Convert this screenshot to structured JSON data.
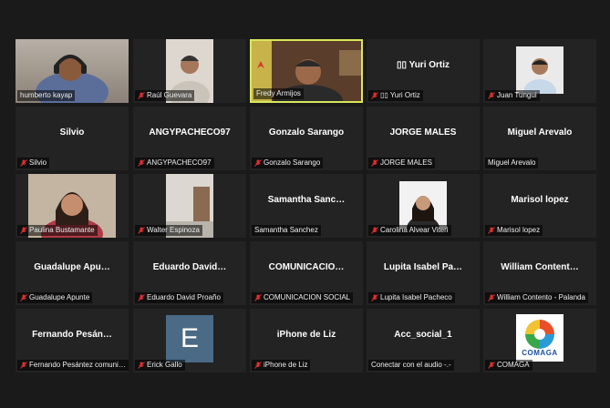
{
  "meeting": {
    "participants": [
      {
        "id": "humberto",
        "display": "video",
        "label": "humberto kayap",
        "muted": false
      },
      {
        "id": "raul",
        "display": "video",
        "label": "Raúl Guevara",
        "muted": true
      },
      {
        "id": "fredy",
        "display": "video",
        "label": "Fredy Armijos",
        "muted": false,
        "active": true
      },
      {
        "id": "yuri",
        "display": "name",
        "center_name": "▯▯ Yuri  Ortiz",
        "label": "▯▯ Yuri Ortiz",
        "muted": true
      },
      {
        "id": "juan",
        "display": "video",
        "label": "Juan Tungui",
        "muted": true
      },
      {
        "id": "silvio",
        "display": "name",
        "center_name": "Silvio",
        "label": "Silvio",
        "muted": true
      },
      {
        "id": "angy",
        "display": "name",
        "center_name": "ANGYPACHECO97",
        "label": "ANGYPACHECO97",
        "muted": true
      },
      {
        "id": "gonzalo",
        "display": "name",
        "center_name": "Gonzalo Sarango",
        "label": "Gonzalo Sarango",
        "muted": true
      },
      {
        "id": "jorge",
        "display": "name",
        "center_name": "JORGE MALES",
        "label": "JORGE MALES",
        "muted": true
      },
      {
        "id": "miguel",
        "display": "name",
        "center_name": "Miguel Arevalo",
        "label": "Miguel Arevalo",
        "muted": false
      },
      {
        "id": "paulina",
        "display": "video",
        "label": "Paulina Bustamante",
        "muted": true
      },
      {
        "id": "walter",
        "display": "video",
        "label": "Walter Espinoza",
        "muted": true
      },
      {
        "id": "samantha",
        "display": "name",
        "center_name": "Samantha  Sanc…",
        "label": "Samantha Sanchez",
        "muted": false
      },
      {
        "id": "carolina",
        "display": "video",
        "label": "Carolina Alvear Viteri",
        "muted": true
      },
      {
        "id": "marisol",
        "display": "name",
        "center_name": "Marisol lopez",
        "label": "Marisol lopez",
        "muted": true
      },
      {
        "id": "guadalupe",
        "display": "name",
        "center_name": "Guadalupe  Apu…",
        "label": "Guadalupe Apunte",
        "muted": true
      },
      {
        "id": "eduardo",
        "display": "name",
        "center_name": "Eduardo  David…",
        "label": "Eduardo David Proaño",
        "muted": true
      },
      {
        "id": "comunicacion",
        "display": "name",
        "center_name": "COMUNICACIO…",
        "label": "COMUNICACION SOCIAL",
        "muted": true
      },
      {
        "id": "lupita",
        "display": "name",
        "center_name": "Lupita  Isabel  Pa…",
        "label": "Lupita Isabel Pacheco",
        "muted": true
      },
      {
        "id": "william",
        "display": "name",
        "center_name": "William  Content…",
        "label": "William Contento - Palanda",
        "muted": true
      },
      {
        "id": "fernando",
        "display": "name",
        "center_name": "Fernando  Pesán…",
        "label": "Fernando Pesántez comuni…",
        "muted": true
      },
      {
        "id": "erick",
        "display": "avatar",
        "avatar_letter": "E",
        "label": "Erick Gallo",
        "muted": true
      },
      {
        "id": "iphone",
        "display": "name",
        "center_name": "iPhone de Liz",
        "label": "iPhone de Liz",
        "muted": true
      },
      {
        "id": "acc",
        "display": "name",
        "center_name": "Acc_social_1",
        "label": "Conectar con el audio -.-",
        "muted": false
      },
      {
        "id": "comaga",
        "display": "logo",
        "logo_text": "COMAGA",
        "logo_subtext": "Consorcio de Municipios Amazónicos y Galápagos",
        "label": "COMAGA",
        "muted": true
      }
    ]
  },
  "colors": {
    "background": "#1a1a1a",
    "tile": "#232323",
    "active_speaker_border": "#d8e85a",
    "muted_icon": "#e03030",
    "avatar": "#4a6a86"
  }
}
